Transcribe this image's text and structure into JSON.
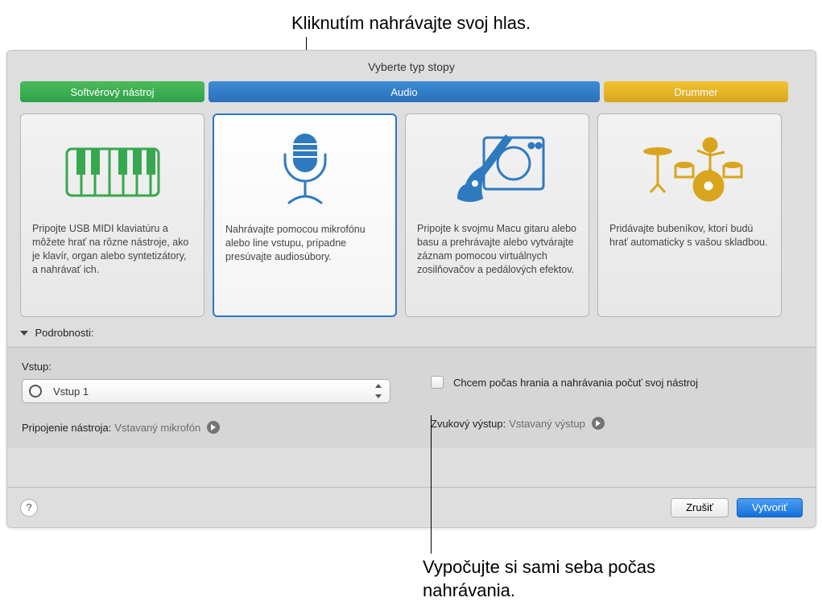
{
  "callouts": {
    "top": "Kliknutím nahrávajte svoj hlas.",
    "bottom": "Vypočujte si sami seba počas nahrávania."
  },
  "dialog": {
    "title": "Vyberte typ stopy",
    "tabs": {
      "software": "Softvérový nástroj",
      "audio": "Audio",
      "drummer": "Drummer"
    },
    "cards": [
      {
        "text": "Pripojte USB MIDI klaviatúru a môžete hrať na rôzne nástroje, ako je klavír, organ alebo syntetizátory, a nahrávať ich."
      },
      {
        "text": "Nahrávajte pomocou mikrofónu alebo line vstupu, prípadne presúvajte audiosúbory."
      },
      {
        "text": "Pripojte k svojmu Macu gitaru alebo basu a prehrávajte alebo vytvárajte záznam pomocou virtuálnych zosilňovačov a pedálových efektov."
      },
      {
        "text": "Pridávajte bubeníkov, ktorí budú hrať automaticky s vašou skladbou."
      }
    ],
    "details_label": "Podrobnosti:",
    "input_label": "Vstup:",
    "input_value": "Vstup 1",
    "monitor_checkbox": "Chcem počas hrania a nahrávania počuť svoj nástroj",
    "connection_label": "Pripojenie nástroja:",
    "connection_value": "Vstavaný mikrofón",
    "output_label": "Zvukový výstup:",
    "output_value": "Vstavaný výstup",
    "help": "?",
    "cancel": "Zrušiť",
    "create": "Vytvoriť"
  },
  "colors": {
    "green": "#37a84f",
    "blue": "#2f7abf",
    "yellow": "#d9a51e",
    "accent": "#166fd8"
  }
}
